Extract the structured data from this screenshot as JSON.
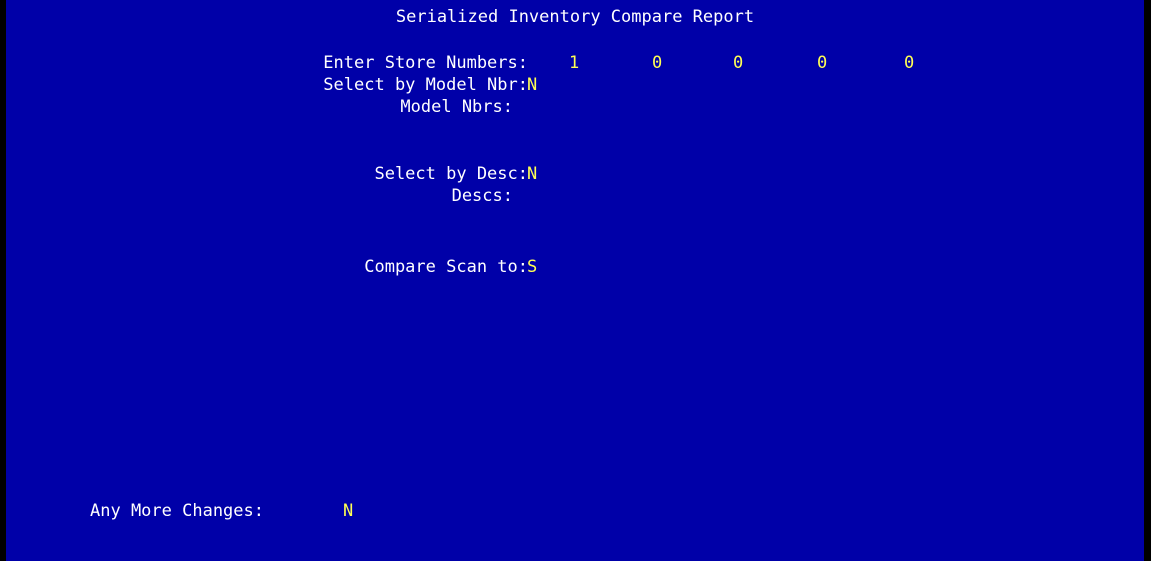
{
  "title": "Serialized Inventory Compare Report",
  "colors": {
    "background": "#0000a8",
    "label": "#ffffff",
    "value": "#ffff54",
    "border": "#000000"
  },
  "store_numbers": {
    "label": "Enter Store Numbers:",
    "values": [
      "1",
      "0",
      "0",
      "0",
      "0"
    ]
  },
  "select_by_model": {
    "label": "Select by Model Nbr:",
    "value": "N"
  },
  "model_nbrs": {
    "label": "Model Nbrs:",
    "value": ""
  },
  "select_by_desc": {
    "label": "Select by Desc:",
    "value": "N"
  },
  "descs": {
    "label": "Descs:",
    "value": ""
  },
  "compare_scan": {
    "label": "Compare Scan to:",
    "value": "S"
  },
  "more_changes": {
    "label": "Any More Changes:",
    "value": "N"
  }
}
